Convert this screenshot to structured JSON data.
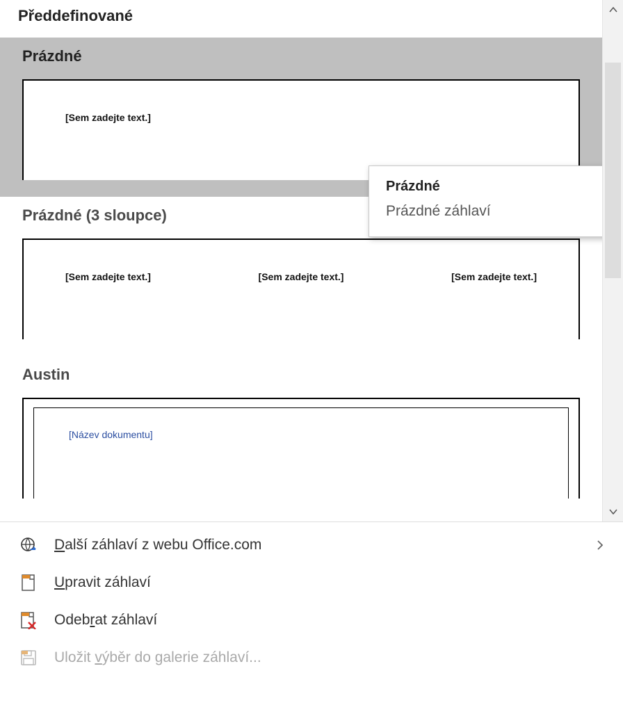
{
  "section_title": "Předdefinované",
  "items": [
    {
      "label": "Prázdné",
      "placeholders": [
        "[Sem zadejte text.]"
      ]
    },
    {
      "label": "Prázdné (3 sloupce)",
      "placeholders": [
        "[Sem zadejte text.]",
        "[Sem zadejte text.]",
        "[Sem zadejte text.]"
      ]
    },
    {
      "label": "Austin",
      "doc_title_placeholder": "[Název dokumentu]"
    }
  ],
  "tooltip": {
    "title": "Prázdné",
    "desc": "Prázdné záhlaví"
  },
  "menu": {
    "more_from_office": "Další záhlaví z webu Office.com",
    "edit_header": "Upravit záhlaví",
    "remove_header": "Odebrat záhlaví",
    "save_selection": "Uložit výběr do galerie záhlaví..."
  }
}
